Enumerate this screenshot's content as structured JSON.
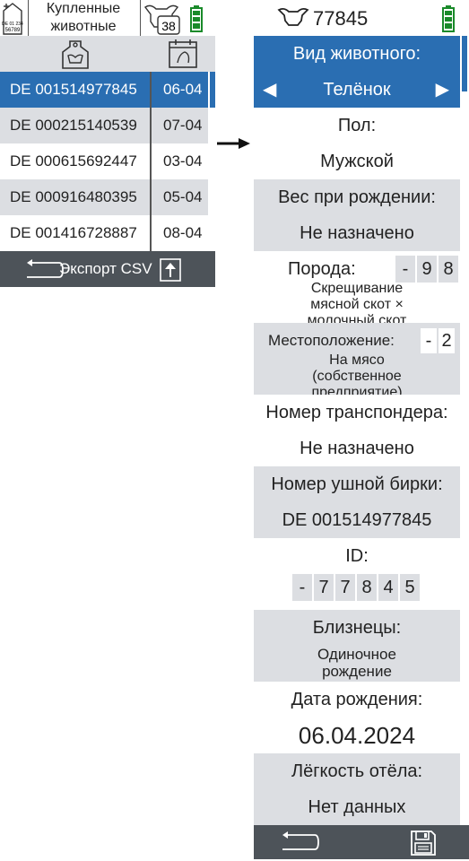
{
  "left_panel": {
    "title_line1": "Купленные",
    "title_line2": "животные",
    "tag_icon_text_top": "DE 01 234",
    "tag_icon_text_bottom": "56789",
    "cow_count": "38",
    "rows": [
      {
        "tag": "DE 001514977845",
        "date": "06-04",
        "selected": true
      },
      {
        "tag": "DE 000215140539",
        "date": "07-04",
        "selected": false
      },
      {
        "tag": "DE 000615692447",
        "date": "03-04",
        "selected": false
      },
      {
        "tag": "DE 000916480395",
        "date": "05-04",
        "selected": false
      },
      {
        "tag": "DE 001416728887",
        "date": "08-04",
        "selected": false
      }
    ],
    "export_label": "Экспорт CSV"
  },
  "right_panel": {
    "status_id": "77845",
    "animal_type_label": "Вид животного:",
    "animal_type_value": "Телёнок",
    "sex_label": "Пол:",
    "sex_value": "Мужской",
    "birth_weight_label": "Вес при рождении:",
    "birth_weight_value": "Не назначено",
    "breed_label": "Порода:",
    "breed_digits": [
      "-",
      "9",
      "8"
    ],
    "breed_text_1": "Скрещивание",
    "breed_text_2": "мясной скот ×",
    "breed_text_3": "молочный скот",
    "location_label": "Местоположение:",
    "location_digits": [
      "-",
      "2"
    ],
    "location_text_1": "На мясо",
    "location_text_2": "(собственное",
    "location_text_3": "предприятие)",
    "transponder_label": "Номер транспондера:",
    "transponder_value": "Не назначено",
    "ear_tag_label": "Номер ушной бирки:",
    "ear_tag_value": "DE 001514977845",
    "id_label": "ID:",
    "id_digits": [
      "-",
      "7",
      "7",
      "8",
      "4",
      "5"
    ],
    "twins_label": "Близнецы:",
    "twins_value_1": "Одиночное",
    "twins_value_2": "рождение",
    "birth_date_label": "Дата рождения:",
    "birth_date_value": "06.04.2024",
    "calving_ease_label": "Лёгкость отёла:",
    "calving_ease_value": "Нет данных"
  },
  "colors": {
    "accent": "#2a6eb2",
    "footer": "#4d5359",
    "row_alt": "#dcdee2",
    "battery": "#1a8a2a"
  }
}
